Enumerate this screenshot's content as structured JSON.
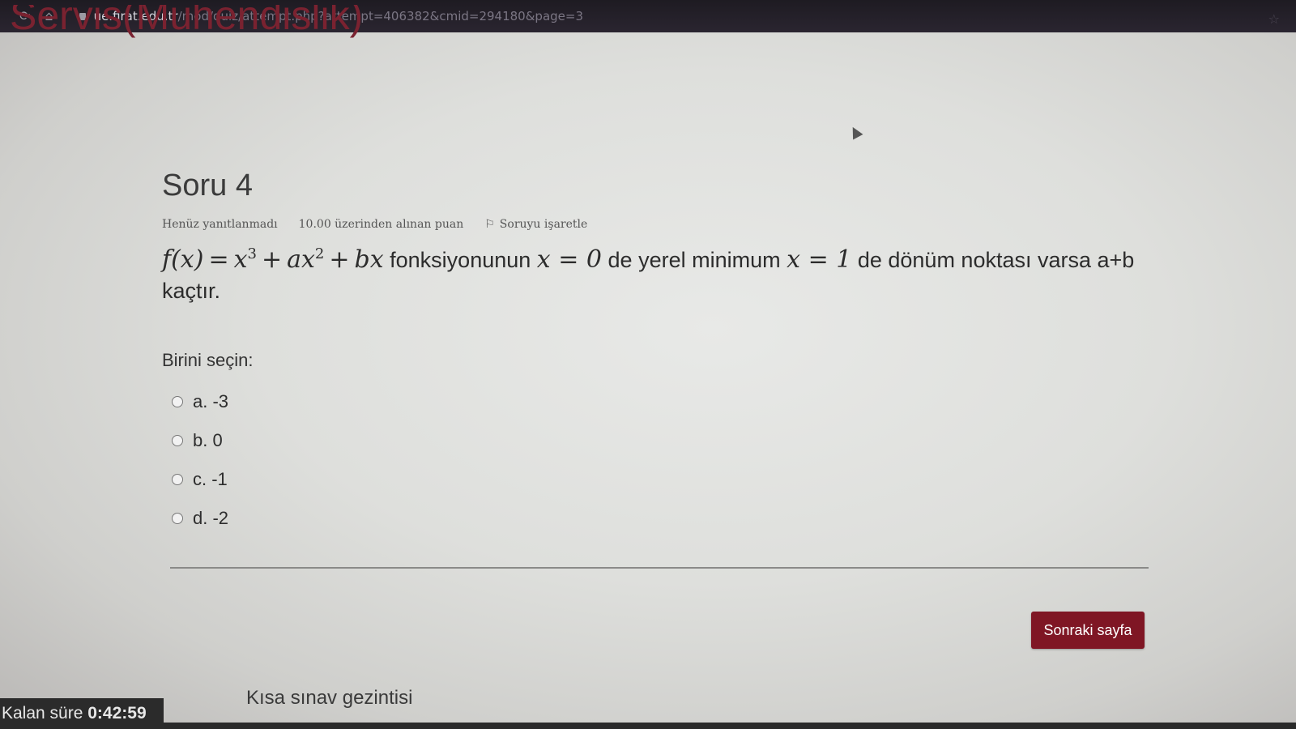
{
  "browser": {
    "url_host": "ue.firat.edu.tr",
    "url_path": "/mod/quiz/attempt.php?attempt=406382&cmid=294180&page=3",
    "reload_glyph": "⟳",
    "home_glyph": "⌂",
    "star_glyph": "☆"
  },
  "site": {
    "title": "Servis(Mühendislik)"
  },
  "question": {
    "title": "Soru 4",
    "status": "Henüz yanıtlanmadı",
    "grade": "10.00 üzerinden alınan puan",
    "flag_label": "Soruyu işaretle",
    "flag_glyph": "⚐",
    "text_part1": "fonksiyonunun",
    "text_part2": "de yerel minimum",
    "text_part3": "de dönüm noktası varsa a+b kaçtır.",
    "math_fx": "f(x)",
    "math_eq": "=",
    "math_x": "x",
    "math_exp3": "3",
    "math_plus": "+",
    "math_ax": "ax",
    "math_exp2": "2",
    "math_bx": "bx",
    "math_x0": "x = 0",
    "math_x1": "x = 1",
    "prompt": "Birini seçin:",
    "answers": [
      {
        "label": "a. -3"
      },
      {
        "label": "b. 0"
      },
      {
        "label": "c. -1"
      },
      {
        "label": "d. -2"
      }
    ]
  },
  "navigation": {
    "next_label": "Sonraki sayfa",
    "quiz_nav_label": "Kısa sınav gezintisi"
  },
  "timer": {
    "label": "Kalan süre",
    "value": "0:42:59"
  }
}
